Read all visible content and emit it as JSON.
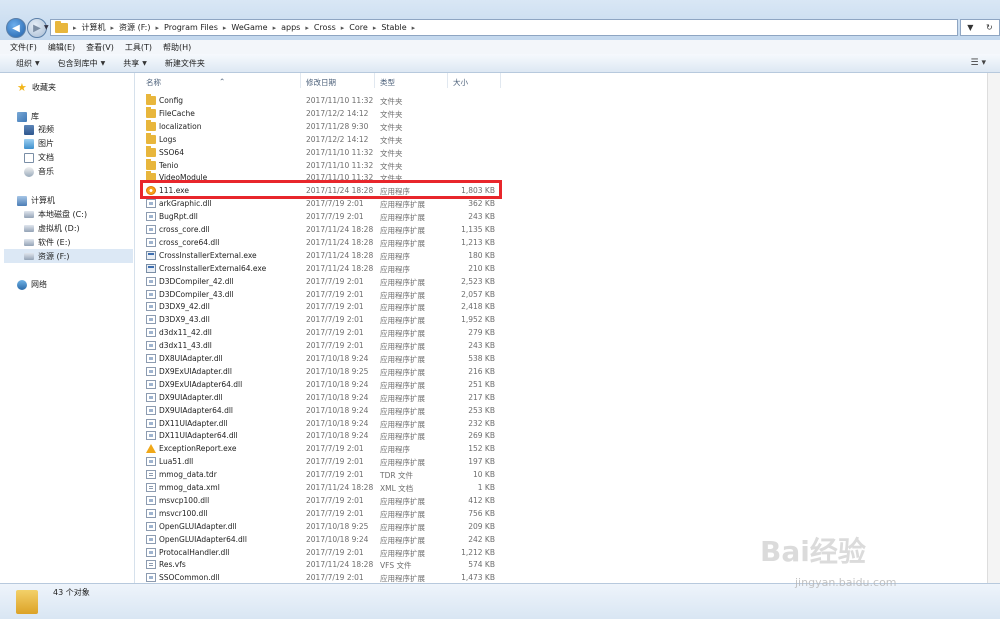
{
  "address": {
    "crumbs": [
      "计算机",
      "资源 (F:)",
      "Program Files",
      "WeGame",
      "apps",
      "Cross",
      "Core",
      "Stable"
    ]
  },
  "menu": [
    "文件(F)",
    "编辑(E)",
    "查看(V)",
    "工具(T)",
    "帮助(H)"
  ],
  "toolbar": {
    "organize": "组织",
    "include_in_library": "包含到库中",
    "share": "共享",
    "new_folder": "新建文件夹"
  },
  "sidebar": {
    "favorites": "收藏夹",
    "libraries": "库",
    "lib_items": [
      "视频",
      "图片",
      "文档",
      "音乐"
    ],
    "computer": "计算机",
    "drives": [
      "本地磁盘 (C:)",
      "虚拟机 (D:)",
      "软件 (E:)",
      "资源 (F:)"
    ],
    "network": "网络"
  },
  "columns": {
    "name": "名称",
    "date": "修改日期",
    "type": "类型",
    "size": "大小"
  },
  "files": [
    {
      "name": "Config",
      "date": "2017/11/10 11:32",
      "type": "文件夹",
      "size": "",
      "icon": "folder"
    },
    {
      "name": "FileCache",
      "date": "2017/12/2 14:12",
      "type": "文件夹",
      "size": "",
      "icon": "folder"
    },
    {
      "name": "localization",
      "date": "2017/11/28 9:30",
      "type": "文件夹",
      "size": "",
      "icon": "folder"
    },
    {
      "name": "Logs",
      "date": "2017/12/2 14:12",
      "type": "文件夹",
      "size": "",
      "icon": "folder"
    },
    {
      "name": "SSO64",
      "date": "2017/11/10 11:32",
      "type": "文件夹",
      "size": "",
      "icon": "folder"
    },
    {
      "name": "Tenio",
      "date": "2017/11/10 11:32",
      "type": "文件夹",
      "size": "",
      "icon": "folder"
    },
    {
      "name": "VideoModule",
      "date": "2017/11/10 11:32",
      "type": "文件夹",
      "size": "",
      "icon": "folder"
    },
    {
      "name": "111.exe",
      "date": "2017/11/24 18:28",
      "type": "应用程序",
      "size": "1,803 KB",
      "icon": "app"
    },
    {
      "name": "arkGraphic.dll",
      "date": "2017/7/19 2:01",
      "type": "应用程序扩展",
      "size": "362 KB",
      "icon": "dll"
    },
    {
      "name": "BugRpt.dll",
      "date": "2017/7/19 2:01",
      "type": "应用程序扩展",
      "size": "243 KB",
      "icon": "dll"
    },
    {
      "name": "cross_core.dll",
      "date": "2017/11/24 18:28",
      "type": "应用程序扩展",
      "size": "1,135 KB",
      "icon": "dll"
    },
    {
      "name": "cross_core64.dll",
      "date": "2017/11/24 18:28",
      "type": "应用程序扩展",
      "size": "1,213 KB",
      "icon": "dll"
    },
    {
      "name": "CrossInstallerExternal.exe",
      "date": "2017/11/24 18:28",
      "type": "应用程序",
      "size": "180 KB",
      "icon": "exe"
    },
    {
      "name": "CrossInstallerExternal64.exe",
      "date": "2017/11/24 18:28",
      "type": "应用程序",
      "size": "210 KB",
      "icon": "exe"
    },
    {
      "name": "D3DCompiler_42.dll",
      "date": "2017/7/19 2:01",
      "type": "应用程序扩展",
      "size": "2,523 KB",
      "icon": "dll"
    },
    {
      "name": "D3DCompiler_43.dll",
      "date": "2017/7/19 2:01",
      "type": "应用程序扩展",
      "size": "2,057 KB",
      "icon": "dll"
    },
    {
      "name": "D3DX9_42.dll",
      "date": "2017/7/19 2:01",
      "type": "应用程序扩展",
      "size": "2,418 KB",
      "icon": "dll"
    },
    {
      "name": "D3DX9_43.dll",
      "date": "2017/7/19 2:01",
      "type": "应用程序扩展",
      "size": "1,952 KB",
      "icon": "dll"
    },
    {
      "name": "d3dx11_42.dll",
      "date": "2017/7/19 2:01",
      "type": "应用程序扩展",
      "size": "279 KB",
      "icon": "dll"
    },
    {
      "name": "d3dx11_43.dll",
      "date": "2017/7/19 2:01",
      "type": "应用程序扩展",
      "size": "243 KB",
      "icon": "dll"
    },
    {
      "name": "DX8UIAdapter.dll",
      "date": "2017/10/18 9:24",
      "type": "应用程序扩展",
      "size": "538 KB",
      "icon": "dll"
    },
    {
      "name": "DX9ExUIAdapter.dll",
      "date": "2017/10/18 9:25",
      "type": "应用程序扩展",
      "size": "216 KB",
      "icon": "dll"
    },
    {
      "name": "DX9ExUIAdapter64.dll",
      "date": "2017/10/18 9:24",
      "type": "应用程序扩展",
      "size": "251 KB",
      "icon": "dll"
    },
    {
      "name": "DX9UIAdapter.dll",
      "date": "2017/10/18 9:24",
      "type": "应用程序扩展",
      "size": "217 KB",
      "icon": "dll"
    },
    {
      "name": "DX9UIAdapter64.dll",
      "date": "2017/10/18 9:24",
      "type": "应用程序扩展",
      "size": "253 KB",
      "icon": "dll"
    },
    {
      "name": "DX11UIAdapter.dll",
      "date": "2017/10/18 9:24",
      "type": "应用程序扩展",
      "size": "232 KB",
      "icon": "dll"
    },
    {
      "name": "DX11UIAdapter64.dll",
      "date": "2017/10/18 9:24",
      "type": "应用程序扩展",
      "size": "269 KB",
      "icon": "dll"
    },
    {
      "name": "ExceptionReport.exe",
      "date": "2017/7/19 2:01",
      "type": "应用程序",
      "size": "152 KB",
      "icon": "warn"
    },
    {
      "name": "Lua51.dll",
      "date": "2017/7/19 2:01",
      "type": "应用程序扩展",
      "size": "197 KB",
      "icon": "dll"
    },
    {
      "name": "mmog_data.tdr",
      "date": "2017/7/19 2:01",
      "type": "TDR 文件",
      "size": "10 KB",
      "icon": "doc"
    },
    {
      "name": "mmog_data.xml",
      "date": "2017/11/24 18:28",
      "type": "XML 文档",
      "size": "1 KB",
      "icon": "doc"
    },
    {
      "name": "msvcp100.dll",
      "date": "2017/7/19 2:01",
      "type": "应用程序扩展",
      "size": "412 KB",
      "icon": "dll"
    },
    {
      "name": "msvcr100.dll",
      "date": "2017/7/19 2:01",
      "type": "应用程序扩展",
      "size": "756 KB",
      "icon": "dll"
    },
    {
      "name": "OpenGLUIAdapter.dll",
      "date": "2017/10/18 9:25",
      "type": "应用程序扩展",
      "size": "209 KB",
      "icon": "dll"
    },
    {
      "name": "OpenGLUIAdapter64.dll",
      "date": "2017/10/18 9:24",
      "type": "应用程序扩展",
      "size": "242 KB",
      "icon": "dll"
    },
    {
      "name": "ProtocalHandler.dll",
      "date": "2017/7/19 2:01",
      "type": "应用程序扩展",
      "size": "1,212 KB",
      "icon": "dll"
    },
    {
      "name": "Res.vfs",
      "date": "2017/11/24 18:28",
      "type": "VFS 文件",
      "size": "574 KB",
      "icon": "doc"
    },
    {
      "name": "SSOCommon.dll",
      "date": "2017/7/19 2:01",
      "type": "应用程序扩展",
      "size": "1,473 KB",
      "icon": "dll"
    }
  ],
  "status": {
    "count": "43 个对象"
  },
  "watermark": {
    "brand": "Bai经验",
    "url": "jingyan.baidu.com"
  },
  "colors": {
    "highlight": "#e8262b",
    "accent": "#3e78b6"
  }
}
